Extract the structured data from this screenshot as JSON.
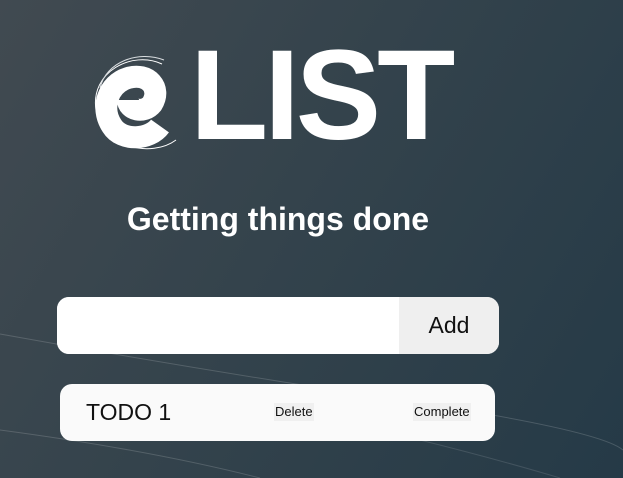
{
  "logo": {
    "text": "LIST",
    "icon": "e-swirl-logo-icon"
  },
  "tagline": "Getting things done",
  "new_todo": {
    "value": "",
    "placeholder": "",
    "add_label": "Add"
  },
  "todos": [
    {
      "text": "TODO 1",
      "delete_label": "Delete",
      "complete_label": "Complete"
    }
  ],
  "colors": {
    "background_start": "#414a51",
    "background_end": "#253a47",
    "card": "#fafafa",
    "button": "#efefef",
    "text_light": "#ffffff"
  }
}
